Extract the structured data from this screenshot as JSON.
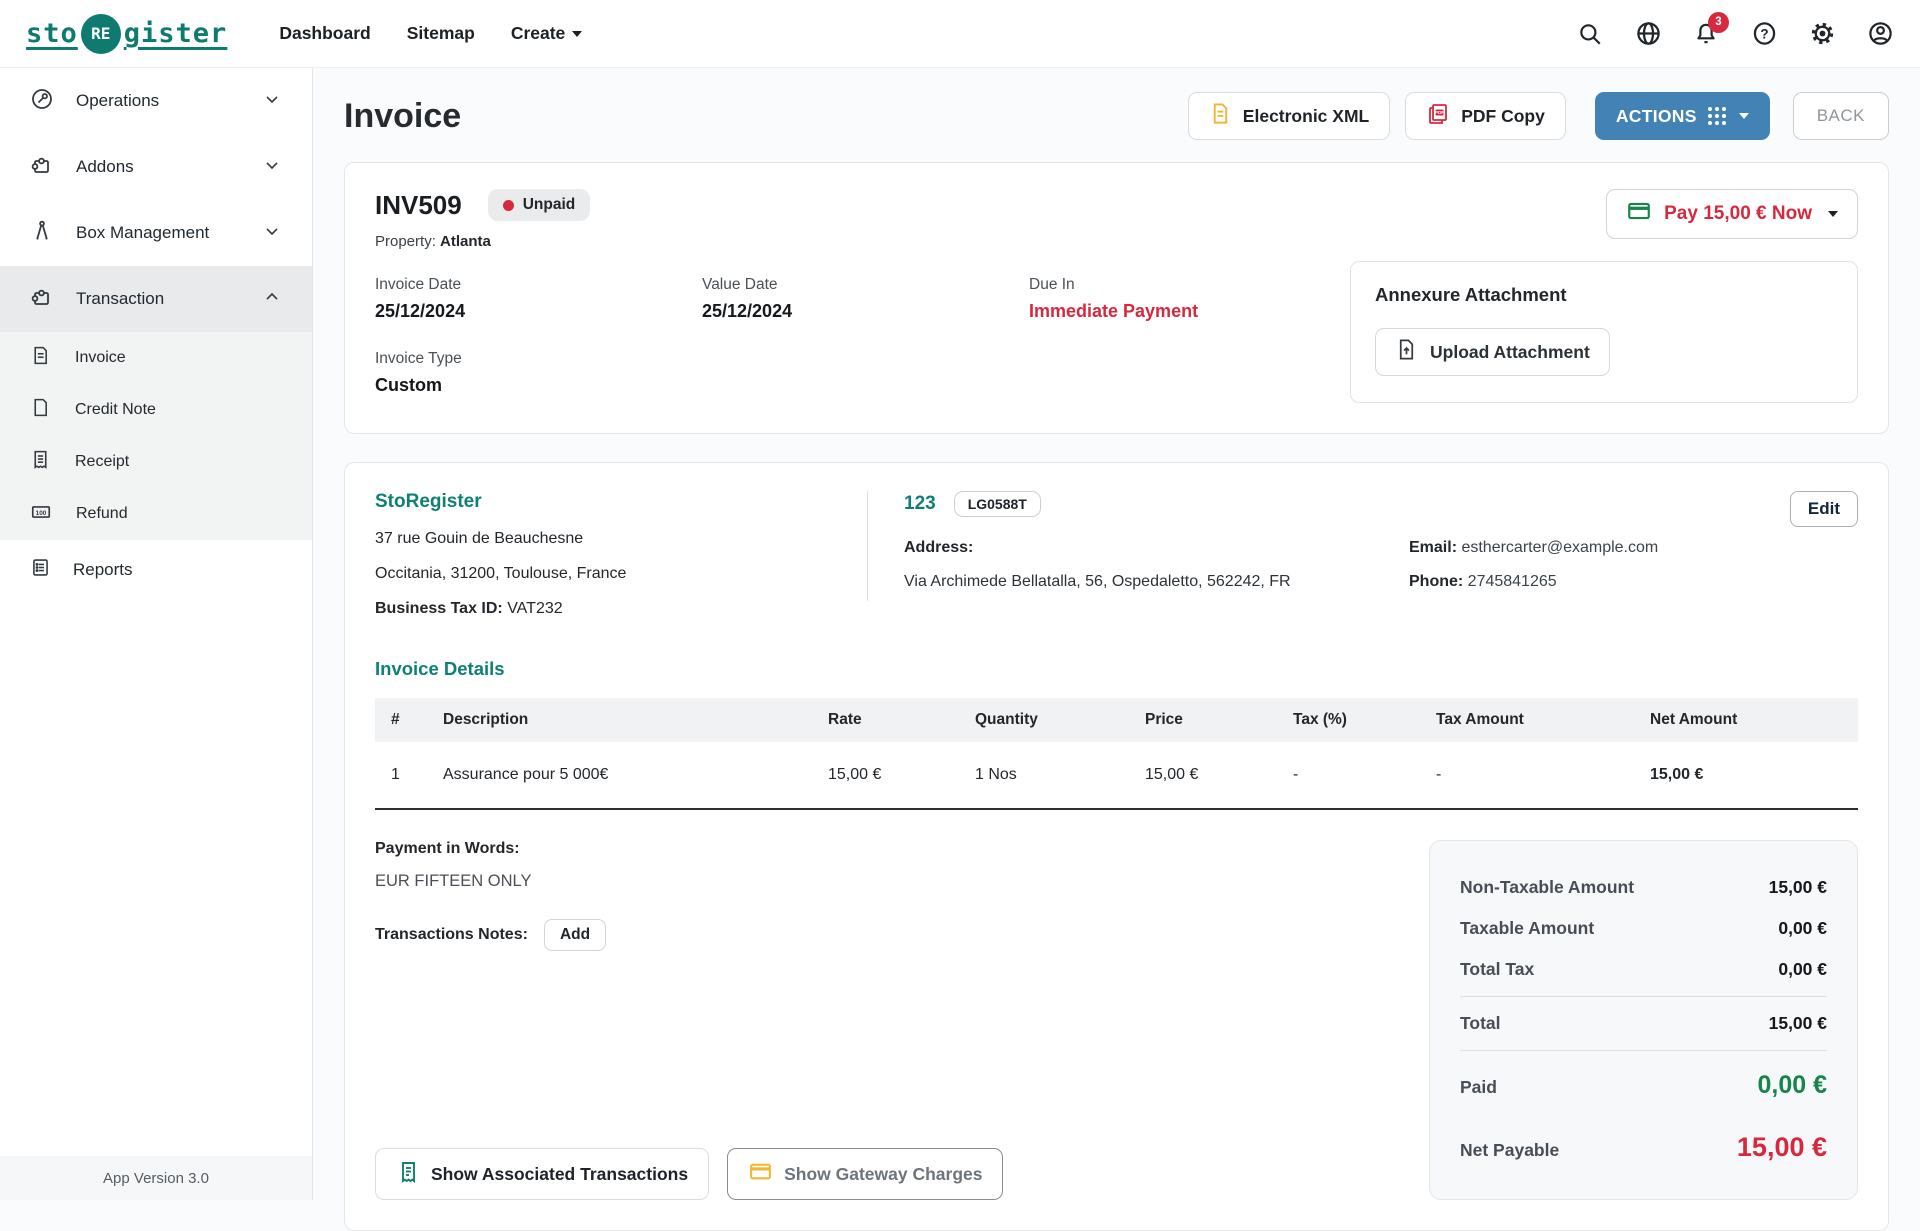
{
  "navbar": {
    "logo": {
      "pre": "sto",
      "mid": "RE",
      "post": "gister"
    },
    "links": [
      {
        "label": "Dashboard"
      },
      {
        "label": "Sitemap"
      },
      {
        "label": "Create"
      }
    ],
    "notification_count": "3"
  },
  "sidebar": {
    "items": [
      {
        "label": "Operations"
      },
      {
        "label": "Addons"
      },
      {
        "label": "Box Management"
      },
      {
        "label": "Transaction"
      }
    ],
    "sub_items": [
      {
        "label": "Invoice"
      },
      {
        "label": "Credit Note"
      },
      {
        "label": "Receipt"
      },
      {
        "label": "Refund"
      }
    ],
    "reports_label": "Reports",
    "app_version": "App Version 3.0"
  },
  "header": {
    "title": "Invoice",
    "xml_button": "Electronic XML",
    "pdf_button": "PDF Copy",
    "actions_button": "ACTIONS",
    "back_button": "BACK"
  },
  "invoice_card": {
    "number": "INV509",
    "status": "Unpaid",
    "property_label": "Property:",
    "property": "Atlanta",
    "fields": [
      {
        "label": "Invoice Date",
        "value": "25/12/2024"
      },
      {
        "label": "Value Date",
        "value": "25/12/2024"
      },
      {
        "label": "Due In",
        "value": "Immediate Payment"
      },
      {
        "label": "Invoice Type",
        "value": "Custom"
      }
    ],
    "pay_button": "Pay 15,00 € Now",
    "annexure_title": "Annexure Attachment",
    "upload_button": "Upload Attachment"
  },
  "company": {
    "name": "StoRegister",
    "address1": "37 rue Gouin de Beauchesne",
    "address2": "Occitania, 31200, Toulouse, France",
    "tax_label": "Business Tax ID:",
    "tax_value": " VAT232"
  },
  "customer": {
    "id": "123",
    "badge": "LG0588T",
    "address_label": "Address:",
    "address": "Via Archimede Bellatalla, 56, Ospedaletto, 562242, FR",
    "email_label": "Email:",
    "email": " esthercarter@example.com",
    "phone_label": "Phone:",
    "phone": " 2745841265",
    "edit_button": "Edit"
  },
  "details": {
    "title": "Invoice Details",
    "columns": [
      "#",
      "Description",
      "Rate",
      "Quantity",
      "Price",
      "Tax (%)",
      "Tax Amount",
      "Net Amount"
    ],
    "rows": [
      [
        "1",
        "Assurance pour 5 000€",
        "15,00 €",
        "1 Nos",
        "15,00 €",
        "-",
        "-",
        "15,00 €"
      ]
    ]
  },
  "payment": {
    "words_label": "Payment in Words:",
    "words": "EUR FIFTEEN ONLY",
    "notes_label": "Transactions Notes:",
    "add_button": "Add"
  },
  "totals": {
    "rows": [
      {
        "label": "Non-Taxable Amount",
        "value": "15,00 €"
      },
      {
        "label": "Taxable Amount",
        "value": "0,00 €"
      },
      {
        "label": "Total Tax",
        "value": "0,00 €"
      },
      {
        "label": "Total",
        "value": "15,00 €"
      },
      {
        "label": "Paid",
        "value": "0,00 €"
      },
      {
        "label": "Net Payable",
        "value": "15,00 €"
      }
    ]
  },
  "footer_buttons": {
    "associated": "Show Associated Transactions",
    "gateway": "Show Gateway Charges"
  },
  "colors": {
    "teal": "#0e8174",
    "blue": "#4282b4",
    "red": "#d6293e",
    "green": "#15854a",
    "yellow": "#f2b632"
  }
}
